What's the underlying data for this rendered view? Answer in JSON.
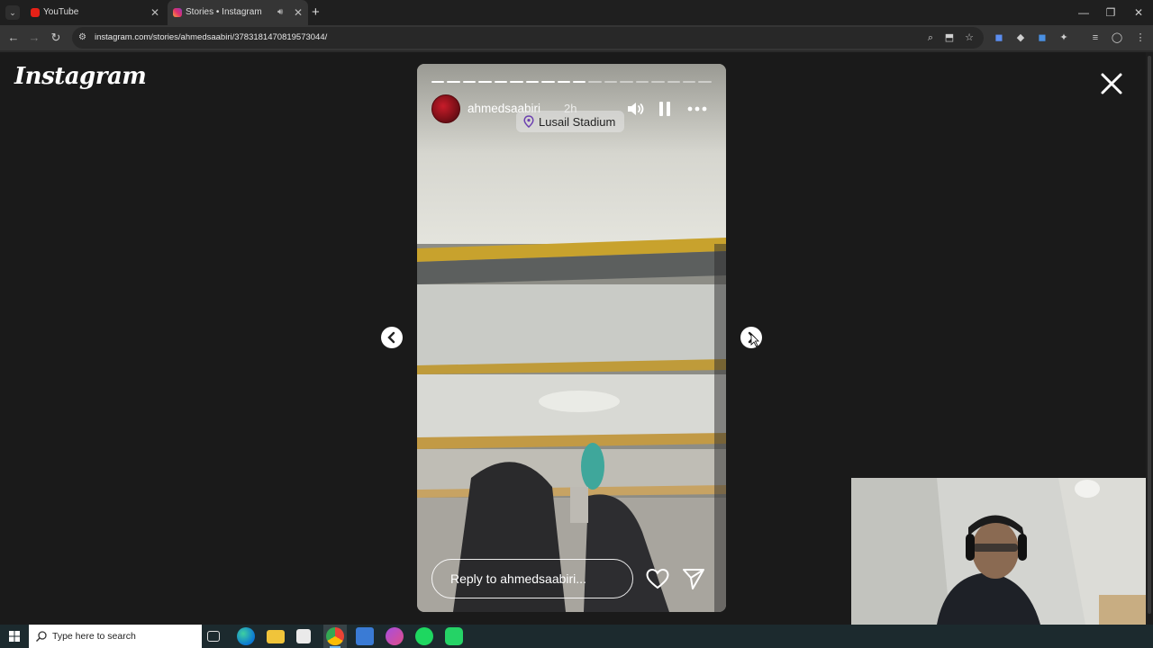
{
  "browser": {
    "tabs": [
      {
        "title": "YouTube",
        "favicon": "youtube-icon",
        "active": false
      },
      {
        "title": "Stories • Instagram",
        "favicon": "instagram-icon",
        "active": true,
        "audio": true
      }
    ],
    "new_tab": "+",
    "url": "instagram.com/stories/ahmedsaabiri/3783181470819573044/"
  },
  "instagram": {
    "logo": "Instagram",
    "story": {
      "username": "ahmedsaabiri",
      "time": "2h",
      "location": "Lusail Stadium",
      "progress_total": 18,
      "progress_done": 10,
      "reply_placeholder": "Reply to ahmedsaabiri..."
    }
  },
  "taskbar": {
    "search_placeholder": "Type here to search"
  },
  "colors": {
    "accent_blue": "#76b9ed",
    "story_red": "#c81c2a",
    "page_bg": "#1a1a1a"
  }
}
